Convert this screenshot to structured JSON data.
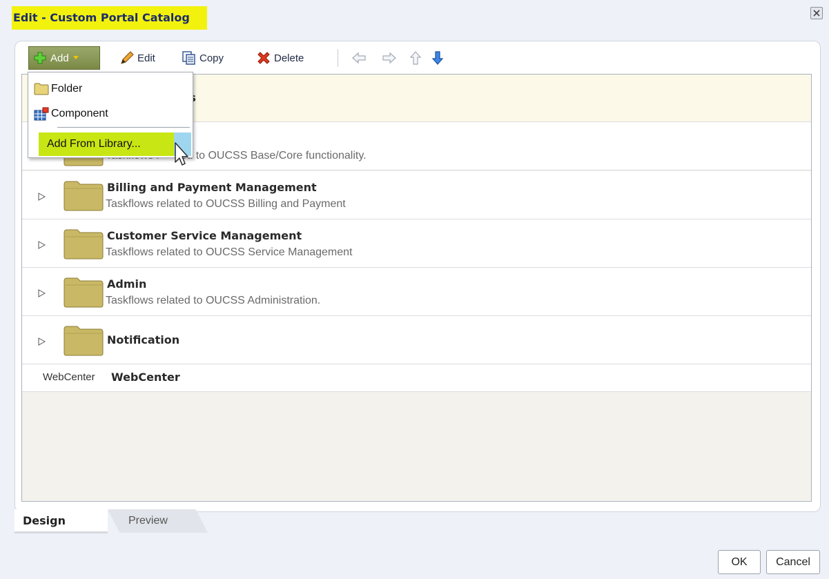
{
  "dialog": {
    "title": "Edit - Custom Portal Catalog",
    "close_icon": "close-icon",
    "highlight_color": "#f2f20e"
  },
  "toolbar": {
    "add_label": "Add",
    "edit_label": "Edit",
    "copy_label": "Copy",
    "delete_label": "Delete",
    "nav_icons": [
      "arrow-left-icon",
      "arrow-right-icon",
      "arrow-up-icon",
      "arrow-down-icon"
    ]
  },
  "add_menu": {
    "items": [
      {
        "label": "Folder",
        "icon": "folder-icon"
      },
      {
        "label": "Component",
        "icon": "component-icon"
      },
      {
        "label": "Add From Library...",
        "icon": ""
      }
    ],
    "highlighted_item": "Add From Library...",
    "highlight_color": "#c8e613"
  },
  "catalog": {
    "top_row_partial": {
      "title_fragment": "vs",
      "desc_fragment_before": "Taskflows r",
      "desc_fragment_after": "ted to OUCSS Base/Core functionality."
    },
    "folders": [
      {
        "title": "Billing and Payment Management",
        "description": "Taskflows related to OUCSS Billing and Payment"
      },
      {
        "title": "Customer Service Management",
        "description": "Taskflows related to OUCSS Service Management"
      },
      {
        "title": "Admin",
        "description": "Taskflows related to OUCSS Administration."
      },
      {
        "title": "Notification",
        "description": ""
      }
    ],
    "webcenter_row": {
      "prefix": "WebCenter",
      "name": "WebCenter"
    }
  },
  "tabs": [
    {
      "label": "Design",
      "selected": true
    },
    {
      "label": "Preview",
      "selected": false
    }
  ],
  "footer": {
    "ok_label": "OK",
    "cancel_label": "Cancel"
  }
}
